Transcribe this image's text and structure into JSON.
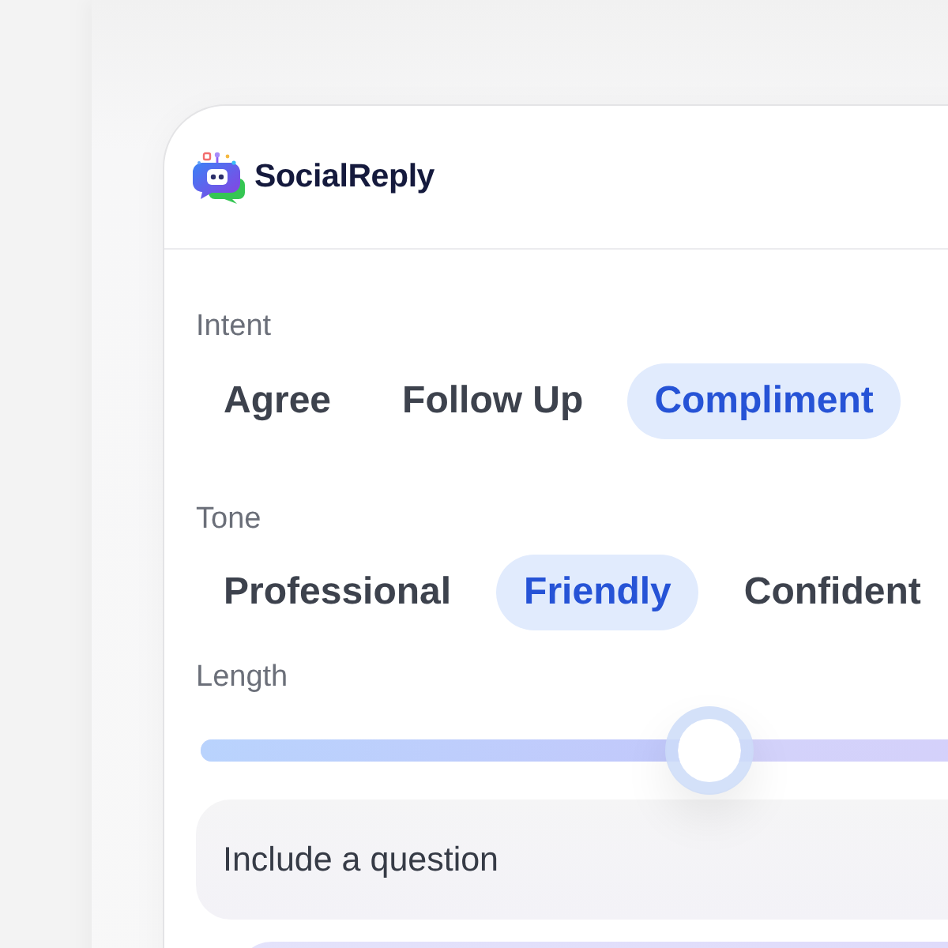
{
  "header": {
    "brand": "SocialReply"
  },
  "intent": {
    "label": "Intent",
    "options": [
      {
        "label": "Agree",
        "selected": false
      },
      {
        "label": "Follow Up",
        "selected": false
      },
      {
        "label": "Compliment",
        "selected": true
      }
    ]
  },
  "tone": {
    "label": "Tone",
    "options": [
      {
        "label": "Professional",
        "selected": false
      },
      {
        "label": "Friendly",
        "selected": true
      },
      {
        "label": "Confident",
        "selected": false
      }
    ]
  },
  "length": {
    "label": "Length",
    "level": 0.5
  },
  "include_question": {
    "label": "Include a question"
  }
}
